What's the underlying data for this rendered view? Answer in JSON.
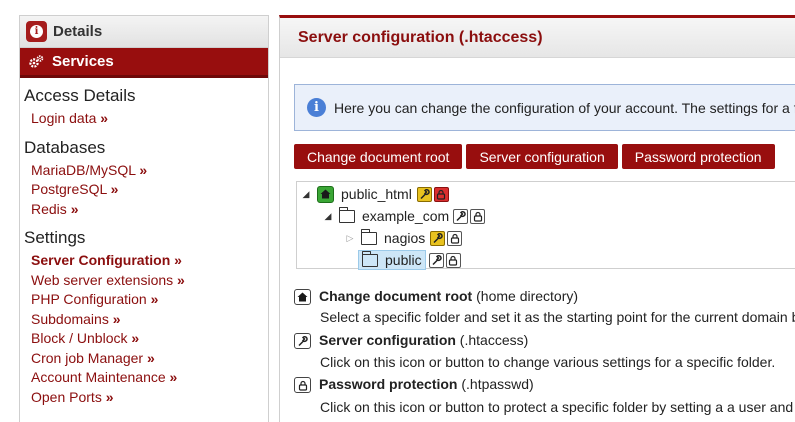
{
  "sidebar": {
    "details_label": "Details",
    "services_label": "Services",
    "sections": [
      {
        "title": "Access Details",
        "items": [
          "Login data"
        ]
      },
      {
        "title": "Databases",
        "items": [
          "MariaDB/MySQL",
          "PostgreSQL",
          "Redis"
        ]
      },
      {
        "title": "Settings",
        "items": [
          "Server Configuration",
          "Web server extensions",
          "PHP Configuration",
          "Subdomains",
          "Block / Unblock",
          "Cron job Manager",
          "Account Maintenance",
          "Open Ports"
        ]
      }
    ],
    "arrow": "»"
  },
  "main": {
    "title": "Server configuration (.htaccess)",
    "info_text": "Here you can change the configuration of your account. The settings for a f",
    "buttons": [
      "Change document root",
      "Server configuration",
      "Password protection"
    ],
    "tree": {
      "root": "public_html",
      "child": "example_com",
      "grandchildren": [
        "nagios",
        "public"
      ]
    },
    "descriptions": [
      {
        "title": "Change document root",
        "suffix": " (home directory)",
        "text": "Select a specific folder and set it as the starting point for the current domain b"
      },
      {
        "title": "Server configuration",
        "suffix": " (.htaccess)",
        "text": "Click on this icon or button to change various settings for a specific folder."
      },
      {
        "title": "Password protection",
        "suffix": " (.htpasswd)",
        "text": "Click on this icon or button to protect a specific folder by setting a a user and"
      }
    ]
  },
  "colors": {
    "brand": "#980e0e",
    "link": "#8b0e0e",
    "info_bg": "#eaf0fa",
    "home_green": "#3aa635",
    "wrench_yellow": "#e8c21f",
    "lock_red": "#d92e2e"
  }
}
